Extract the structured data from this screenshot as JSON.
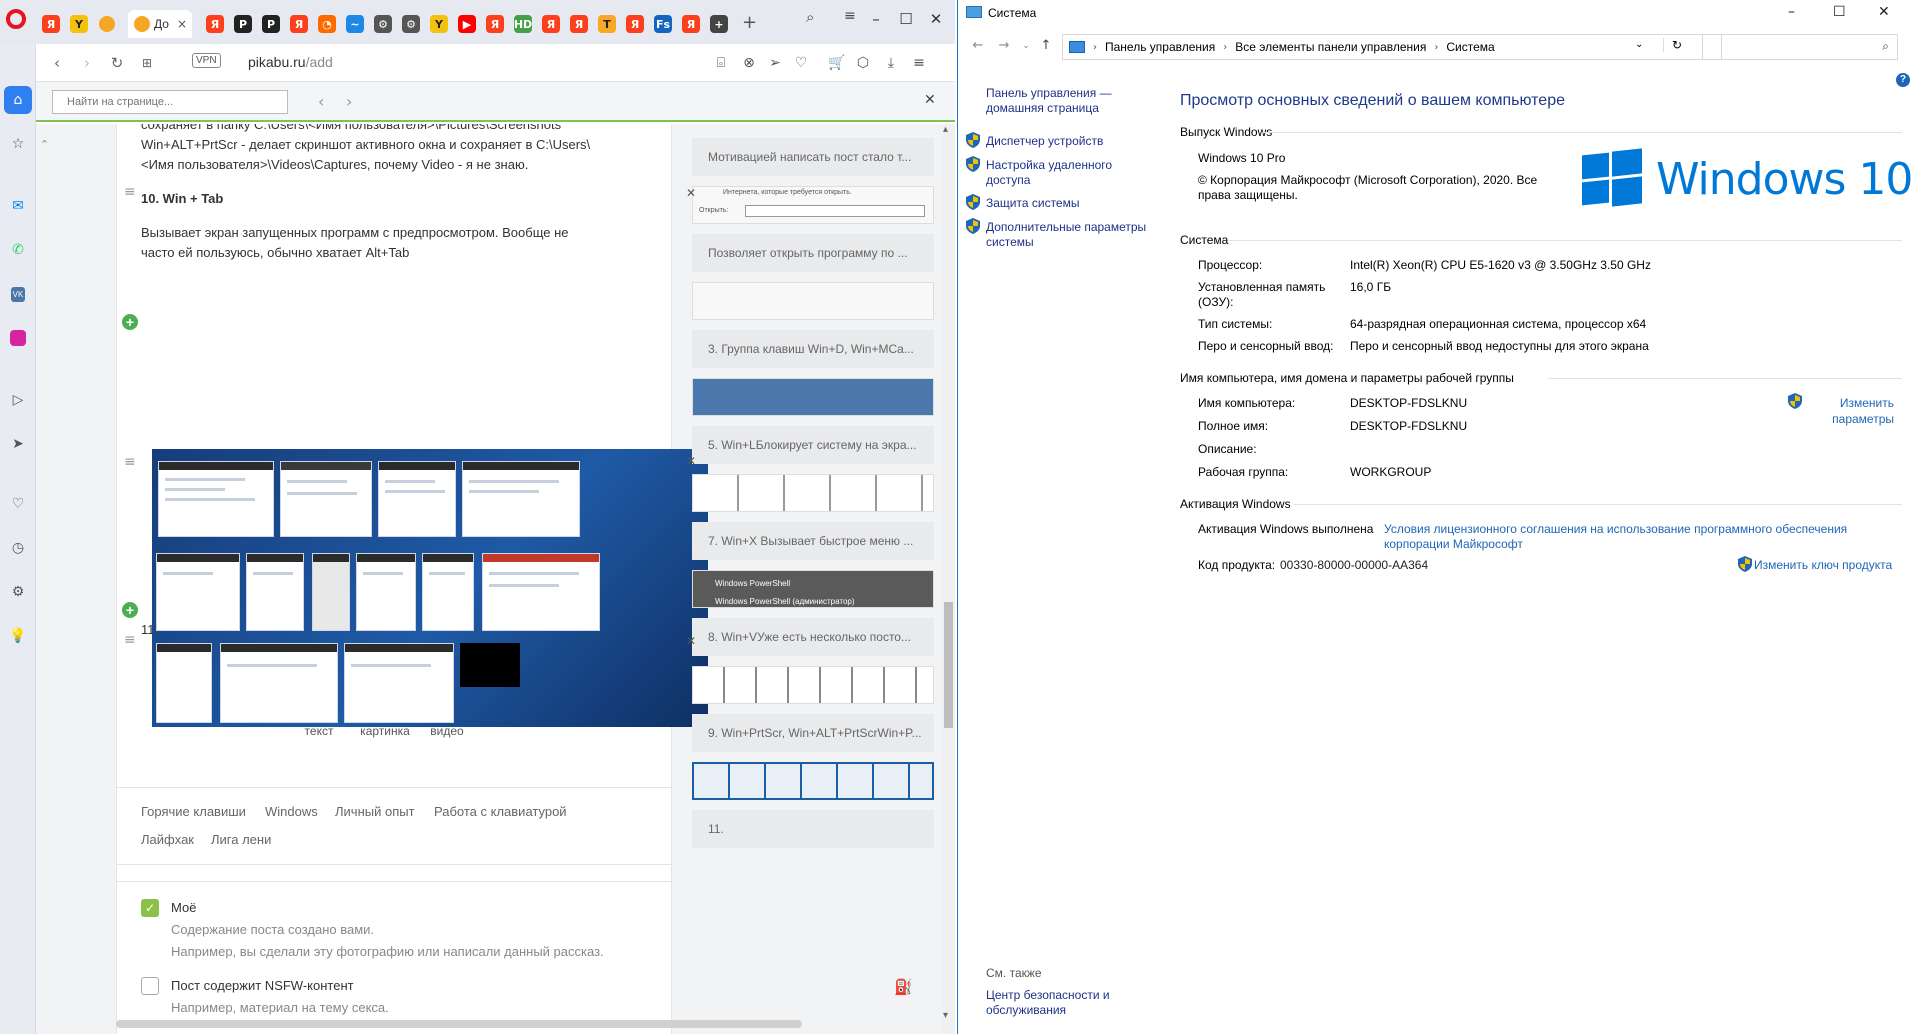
{
  "browser": {
    "active_tab_title": "До",
    "url_host": "pikabu.ru",
    "url_path": "/add",
    "vpn_label": "VPN",
    "find_placeholder": "Найти на странице...",
    "tabs": [
      {
        "icon": "yandex-icon",
        "letter": "Я",
        "color": "#fc3f1d"
      },
      {
        "icon": "yandex-browser-icon",
        "letter": "Y",
        "color": "#f4c20d"
      },
      {
        "icon": "pikabu-icon",
        "letter": "",
        "color": "#f5a623"
      },
      {
        "icon": "pikabu-icon",
        "letter": "",
        "color": "#f5a623"
      },
      {
        "icon": "yandex-icon",
        "letter": "Я",
        "color": "#fc3f1d"
      },
      {
        "icon": "p-icon",
        "letter": "P",
        "color": "#222222"
      },
      {
        "icon": "p-icon",
        "letter": "P",
        "color": "#222222"
      },
      {
        "icon": "yandex-icon",
        "letter": "Я",
        "color": "#fc3f1d"
      },
      {
        "icon": "clock-icon",
        "letter": "◔",
        "color": "#ff6a00"
      },
      {
        "icon": "wave-icon",
        "letter": "~",
        "color": "#1e88e5"
      },
      {
        "icon": "gear-icon",
        "letter": "⚙",
        "color": "#555555"
      },
      {
        "icon": "gear-icon",
        "letter": "⚙",
        "color": "#555555"
      },
      {
        "icon": "yandex-browser-icon",
        "letter": "Y",
        "color": "#f4c20d"
      },
      {
        "icon": "youtube-icon",
        "letter": "▶",
        "color": "#ff0000"
      },
      {
        "icon": "yandex-icon",
        "letter": "Я",
        "color": "#fc3f1d"
      },
      {
        "icon": "hd-icon",
        "letter": "HD",
        "color": "#43a047"
      },
      {
        "icon": "yandex-icon",
        "letter": "Я",
        "color": "#fc3f1d"
      },
      {
        "icon": "yandex-icon",
        "letter": "Я",
        "color": "#fc3f1d"
      },
      {
        "icon": "t-icon",
        "letter": "T",
        "color": "#f9a825"
      },
      {
        "icon": "yandex-icon",
        "letter": "Я",
        "color": "#fc3f1d"
      },
      {
        "icon": "fs-icon",
        "letter": "Fs",
        "color": "#1565c0"
      },
      {
        "icon": "yandex-icon",
        "letter": "Я",
        "color": "#fc3f1d"
      },
      {
        "icon": "plus-square-icon",
        "letter": "+",
        "color": "#444444"
      }
    ]
  },
  "post": {
    "para1_line1": "сохраняет в папку C:\\Users\\<Имя пользователя>\\Pictures\\Screenshots",
    "para1_line2": "Win+ALT+PrtScr - делает скриншот активного окна и сохраняет в C:\\Users\\",
    "para1_line3": "<Имя пользователя>\\Videos\\Captures, почему Video - я не знаю.",
    "heading10": "10. Win + Tab",
    "para2_line1": "Вызывает экран запущенных программ с предпросмотром. Вообще не",
    "para2_line2": "часто ей пользуюсь, обычно хватает Alt+Tab",
    "item11": "11.",
    "buttons": {
      "text": "текст",
      "image": "картинка",
      "video": "видео"
    },
    "tags": [
      "Горячие клавиши",
      "Windows",
      "Личный опыт",
      "Работа с клавиатурой",
      "Лайфхак",
      "Лига лени"
    ],
    "options": {
      "mine_label": "Моё",
      "mine_desc1": "Содержание поста создано вами.",
      "mine_desc2": "Например, вы сделали эту фотографию или написали данный рассказ.",
      "nsfw_label": "Пост содержит NSFW-контент",
      "nsfw_desc1": "Например, материал на тему секса."
    }
  },
  "outline": {
    "items": [
      "Мотивацией написать пост стало т...",
      "Позволяет открыть программу по ...",
      "3. Группа клавиш Win+D, Win+MCa...",
      "5. Win+LБлокирует систему на экра...",
      "7. Win+X Вызывает быстрое меню ...",
      "8. Win+VУже есть несколько посто...",
      "9. Win+PrtScr, Win+ALT+PrtScrWin+P...",
      "11."
    ],
    "dialog_text1": "Интернета, которые требуется открыть.",
    "dialog_text2": "Открыть:",
    "powershell1": "Windows PowerShell",
    "powershell2": "Windows PowerShell (администратор)"
  },
  "system": {
    "window_title": "Система",
    "crumbs": [
      "Панель управления",
      "Все элементы панели управления",
      "Система"
    ],
    "left_links": [
      "Панель управления — домашняя страница",
      "Диспетчер устройств",
      "Настройка удаленного доступа",
      "Защита системы",
      "Дополнительные параметры системы"
    ],
    "see_also": "См. также",
    "security_center": "Центр безопасности и обслуживания",
    "main_title": "Просмотр основных сведений о вашем компьютере",
    "edition_header": "Выпуск Windows",
    "edition": "Windows 10 Pro",
    "copyright": "© Корпорация Майкрософт (Microsoft Corporation), 2020. Все права защищены.",
    "logo_text": "Windows 10",
    "system_header": "Система",
    "processor_label": "Процессор:",
    "processor_value": "Intel(R) Xeon(R) CPU E5-1620 v3 @ 3.50GHz   3.50 GHz",
    "ram_label": "Установленная память (ОЗУ):",
    "ram_value": "16,0 ГБ",
    "systype_label": "Тип системы:",
    "systype_value": "64-разрядная операционная система, процессор x64",
    "pen_label": "Перо и сенсорный ввод:",
    "pen_value": "Перо и сенсорный ввод недоступны для этого экрана",
    "name_header": "Имя компьютера, имя домена и параметры рабочей группы",
    "pcname_label": "Имя компьютера:",
    "pcname_value": "DESKTOP-FDSLKNU",
    "fullname_label": "Полное имя:",
    "fullname_value": "DESKTOP-FDSLKNU",
    "desc_label": "Описание:",
    "workgroup_label": "Рабочая группа:",
    "workgroup_value": "WORKGROUP",
    "change_params": "Изменить параметры",
    "activation_header": "Активация Windows",
    "activation_status": "Активация Windows выполнена",
    "license_link": "Условия лицензионного соглашения на использование программного обеспечения корпорации Майкрософт",
    "product_key_label": "Код продукта:",
    "product_key": "00330-80000-00000-AA364",
    "change_key": "Изменить ключ продукта",
    "accent": "#0078d7",
    "link_color": "#1e66b8"
  }
}
